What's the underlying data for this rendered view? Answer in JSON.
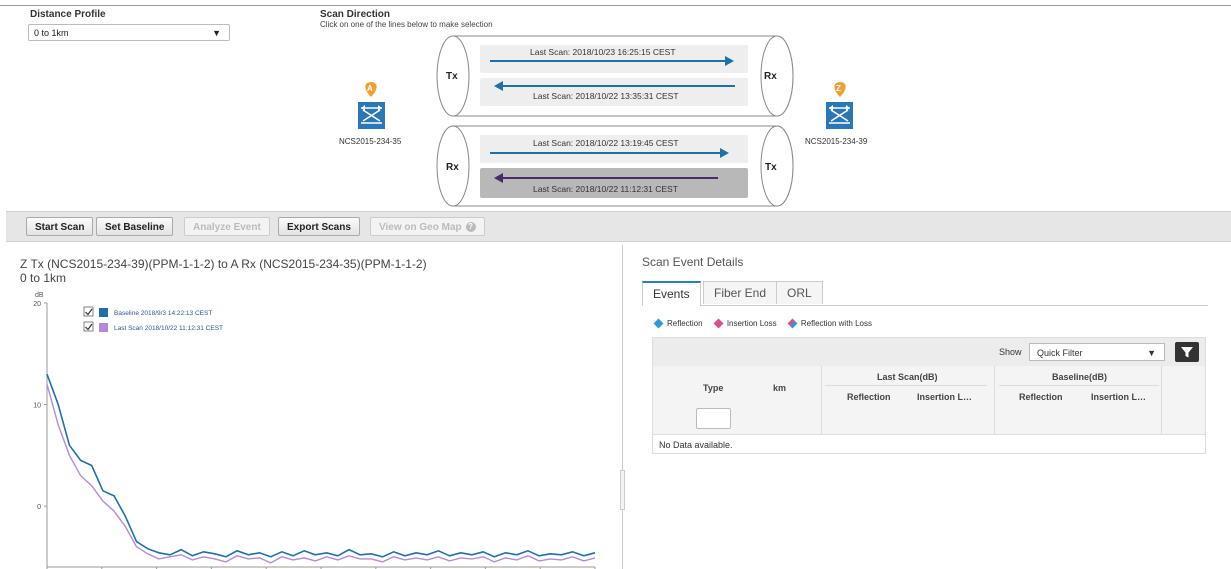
{
  "distance_profile": {
    "label": "Distance Profile",
    "value": "0 to 1km"
  },
  "scan_direction": {
    "label": "Scan Direction",
    "instruction": "Click on one of the lines below to make selection",
    "fiber1": {
      "left_port": "Tx",
      "right_port": "Rx",
      "line_forward": "Last Scan: 2018/10/23 16:25:15 CEST",
      "line_backward": "Last Scan: 2018/10/22 13:35:31 CEST"
    },
    "fiber2": {
      "left_port": "Rx",
      "right_port": "Tx",
      "line_forward": "Last Scan: 2018/10/22 13:19:45 CEST",
      "line_backward": "Last Scan: 2018/10/22 11:12:31 CEST"
    },
    "node_a": {
      "pin": "A",
      "name": "NCS2015-234-35"
    },
    "node_z": {
      "pin": "Z",
      "name": "NCS2015-234-39"
    }
  },
  "toolbar": {
    "start_scan": "Start Scan",
    "set_baseline": "Set Baseline",
    "analyze_event": "Analyze Event",
    "export_scans": "Export Scans",
    "view_geo_map": "View on Geo Map"
  },
  "chart_panel": {
    "title": "Z Tx (NCS2015-234-39)(PPM-1-1-2) to A Rx (NCS2015-234-35)(PPM-1-1-2)",
    "subtitle": "0 to 1km"
  },
  "chart_data": {
    "type": "line",
    "ylabel": "dB",
    "ylim": [
      -6,
      20
    ],
    "yticks": [
      "20",
      "10",
      "0"
    ],
    "series": [
      {
        "name": "Baseline 2018/9/3 14:22:13 CEST",
        "color": "#1f6fa8",
        "checked": true,
        "values": [
          13,
          10,
          6,
          4.5,
          4,
          1.5,
          1,
          -1,
          -3.5,
          -4.2,
          -4.6,
          -4.8,
          -4.3,
          -4.9,
          -4.5,
          -4.7,
          -5,
          -4.4,
          -4.8,
          -4.6,
          -5,
          -4.5,
          -4.9,
          -4.4,
          -4.8,
          -4.6,
          -4.9,
          -4.3,
          -4.8,
          -4.7,
          -5,
          -4.5,
          -4.9,
          -4.6,
          -4.8,
          -4.4,
          -4.9,
          -4.6,
          -4.8,
          -4.5,
          -5,
          -4.6,
          -4.8,
          -4.4,
          -4.9,
          -4.7,
          -4.8,
          -4.5,
          -4.9,
          -4.6
        ]
      },
      {
        "name": "Last Scan 2018/10/22 11:12:31 CEST",
        "color": "#b48ad8",
        "checked": true,
        "values": [
          12,
          8,
          5,
          3,
          2,
          0.5,
          -0.5,
          -2,
          -4,
          -4.7,
          -5.2,
          -5,
          -4.8,
          -5.3,
          -5,
          -5.2,
          -5.5,
          -4.9,
          -5.2,
          -5.1,
          -5.6,
          -5,
          -5.3,
          -5.1,
          -5.4,
          -5,
          -5.3,
          -4.9,
          -5.2,
          -5.2,
          -5.5,
          -5,
          -5.3,
          -5.1,
          -5.3,
          -5,
          -5.4,
          -5.1,
          -5.2,
          -5,
          -5.5,
          -5.1,
          -5.3,
          -4.9,
          -5.4,
          -5.2,
          -5.3,
          -5,
          -5.4,
          -5.1
        ]
      }
    ]
  },
  "scan_event_details": {
    "title": "Scan Event Details",
    "tabs": [
      "Events",
      "Fiber End",
      "ORL"
    ],
    "active_tab": "Events",
    "legend": [
      {
        "label": "Reflection",
        "color": "#2e9bd6"
      },
      {
        "label": "Insertion Loss",
        "color": "#d6508a"
      },
      {
        "label": "Reflection with Loss",
        "color": "#9a7bd6"
      }
    ],
    "show_label": "Show",
    "filter_value": "Quick Filter",
    "columns": {
      "type": "Type",
      "km": "km",
      "last_scan": "Last Scan(dB)",
      "baseline": "Baseline(dB)",
      "reflection": "Reflection",
      "insertion_loss": "Insertion L…"
    },
    "empty_text": "No Data available."
  }
}
